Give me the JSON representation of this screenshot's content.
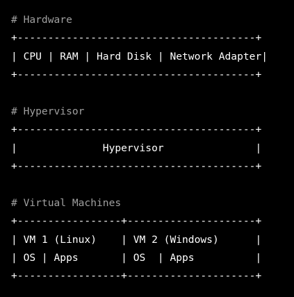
{
  "colors": {
    "background": "#000000",
    "comment": "#a0a0a0",
    "text": "#ffffff"
  },
  "lines": [
    {
      "kind": "comment",
      "text": "# Hardware"
    },
    {
      "kind": "text",
      "text": "+---------------------------------------+"
    },
    {
      "kind": "text",
      "text": "| CPU | RAM | Hard Disk | Network Adapter|"
    },
    {
      "kind": "text",
      "text": "+---------------------------------------+"
    },
    {
      "kind": "text",
      "text": ""
    },
    {
      "kind": "comment",
      "text": "# Hypervisor"
    },
    {
      "kind": "text",
      "text": "+---------------------------------------+"
    },
    {
      "kind": "text",
      "text": "|              Hypervisor               |"
    },
    {
      "kind": "text",
      "text": "+---------------------------------------+"
    },
    {
      "kind": "text",
      "text": ""
    },
    {
      "kind": "comment",
      "text": "# Virtual Machines"
    },
    {
      "kind": "text",
      "text": "+-----------------+---------------------+"
    },
    {
      "kind": "text",
      "text": "| VM 1 (Linux)    | VM 2 (Windows)      |"
    },
    {
      "kind": "text",
      "text": "| OS | Apps       | OS  | Apps          |"
    },
    {
      "kind": "text",
      "text": "+-----------------+---------------------+"
    }
  ]
}
